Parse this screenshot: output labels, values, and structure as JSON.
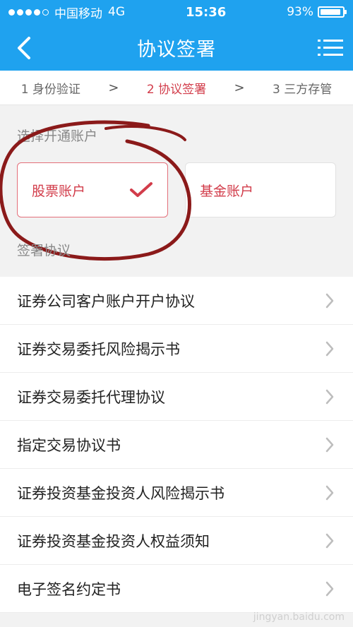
{
  "status_bar": {
    "carrier": "中国移动",
    "network": "4G",
    "time": "15:36",
    "battery_percent": "93%",
    "battery_level": 0.93
  },
  "nav": {
    "title": "协议签署"
  },
  "steps": [
    {
      "label": "1 身份验证",
      "active": false
    },
    {
      "label": "2 协议签署",
      "active": true
    },
    {
      "label": "3 三方存管",
      "active": false
    }
  ],
  "section_open_account": "选择开通账户",
  "accounts": [
    {
      "label": "股票账户",
      "selected": true
    },
    {
      "label": "基金账户",
      "selected": false
    }
  ],
  "section_sign": "签署协议",
  "agreements": [
    "证券公司客户账户开户协议",
    "证券交易委托风险揭示书",
    "证券交易委托代理协议",
    "指定交易协议书",
    "证券投资基金投资人风险揭示书",
    "证券投资基金投资人权益须知",
    "电子签名约定书"
  ],
  "watermark": "jingyan.baidu.com",
  "colors": {
    "primary": "#1fa2ef",
    "accent": "#d23c4a",
    "annotation": "#8b1a1a"
  }
}
